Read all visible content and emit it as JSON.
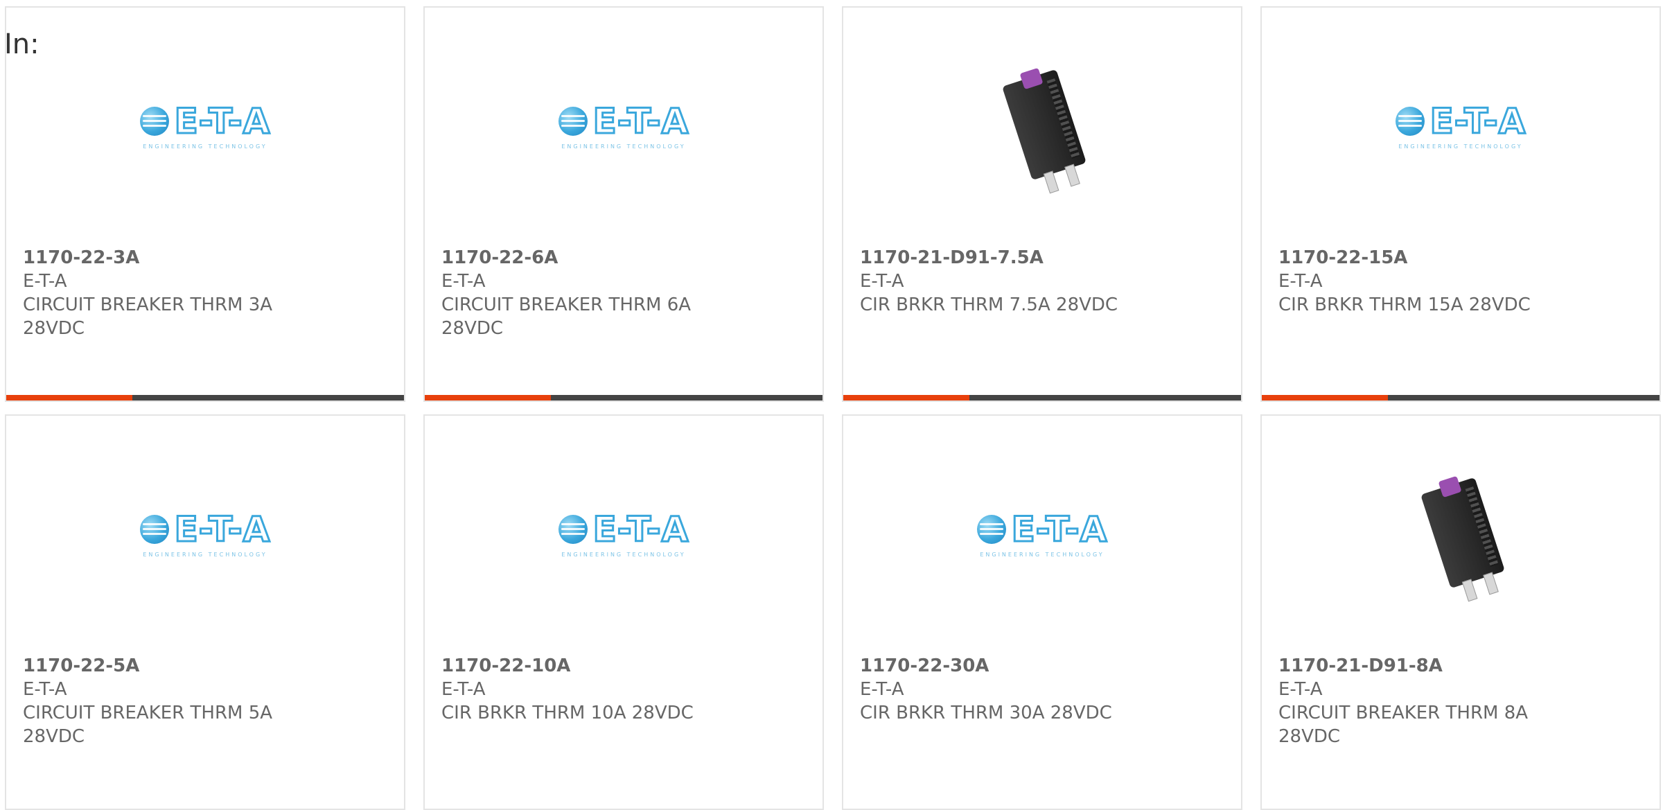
{
  "header": {
    "in_label": "In:"
  },
  "colors": {
    "accent": "#e8400c",
    "bar": "#444444"
  },
  "products": [
    {
      "part": "1170-22-3A",
      "brand": "E-T-A",
      "desc": "CIRCUIT BREAKER THRM 3A 28VDC",
      "image": "eta-logo"
    },
    {
      "part": "1170-22-6A",
      "brand": "E-T-A",
      "desc": "CIRCUIT BREAKER THRM 6A 28VDC",
      "image": "eta-logo"
    },
    {
      "part": "1170-21-D91-7.5A",
      "brand": "E-T-A",
      "desc": "CIR BRKR THRM 7.5A 28VDC",
      "image": "breaker-photo"
    },
    {
      "part": "1170-22-15A",
      "brand": "E-T-A",
      "desc": "CIR BRKR THRM 15A 28VDC",
      "image": "eta-logo"
    },
    {
      "part": "1170-22-5A",
      "brand": "E-T-A",
      "desc": "CIRCUIT BREAKER THRM 5A 28VDC",
      "image": "eta-logo"
    },
    {
      "part": "1170-22-10A",
      "brand": "E-T-A",
      "desc": "CIR BRKR THRM 10A 28VDC",
      "image": "eta-logo"
    },
    {
      "part": "1170-22-30A",
      "brand": "E-T-A",
      "desc": "CIR BRKR THRM 30A 28VDC",
      "image": "eta-logo"
    },
    {
      "part": "1170-21-D91-8A",
      "brand": "E-T-A",
      "desc": "CIRCUIT BREAKER THRM 8A 28VDC",
      "image": "breaker-photo"
    }
  ],
  "logo": {
    "text": "E-T-A",
    "sub": "ENGINEERING TECHNOLOGY"
  }
}
